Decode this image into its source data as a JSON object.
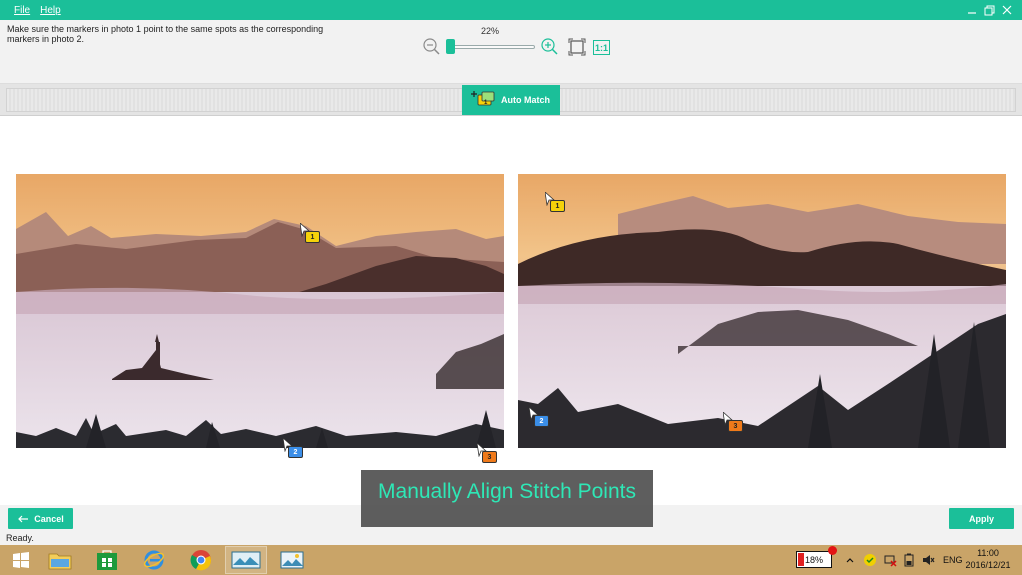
{
  "menu": {
    "file": "File",
    "help": "Help"
  },
  "header": {
    "instruction": "Make sure the markers in photo 1 point to the same spots as the corresponding markers in photo 2.",
    "zoom_percent": "22%",
    "zoom_level": 0.22,
    "actual_size_label": "1:1"
  },
  "toolbar": {
    "auto_match_label": "Auto Match"
  },
  "markers": {
    "photo1": [
      {
        "label": "1",
        "color": "yellow"
      },
      {
        "label": "2",
        "color": "blue"
      },
      {
        "label": "3",
        "color": "orange"
      }
    ],
    "photo2": [
      {
        "label": "1",
        "color": "yellow"
      },
      {
        "label": "2",
        "color": "blue"
      },
      {
        "label": "3",
        "color": "orange"
      }
    ]
  },
  "overlay": {
    "caption": "Manually Align Stitch Points"
  },
  "footer": {
    "cancel_label": "Cancel",
    "apply_label": "Apply",
    "status": "Ready."
  },
  "taskbar": {
    "battery_percent": "18%",
    "language": "ENG",
    "time": "11:00",
    "date": "2016/12/21"
  },
  "colors": {
    "accent": "#1bbf99",
    "taskbar": "#c9a468",
    "caption_text": "#2ee8b6"
  }
}
